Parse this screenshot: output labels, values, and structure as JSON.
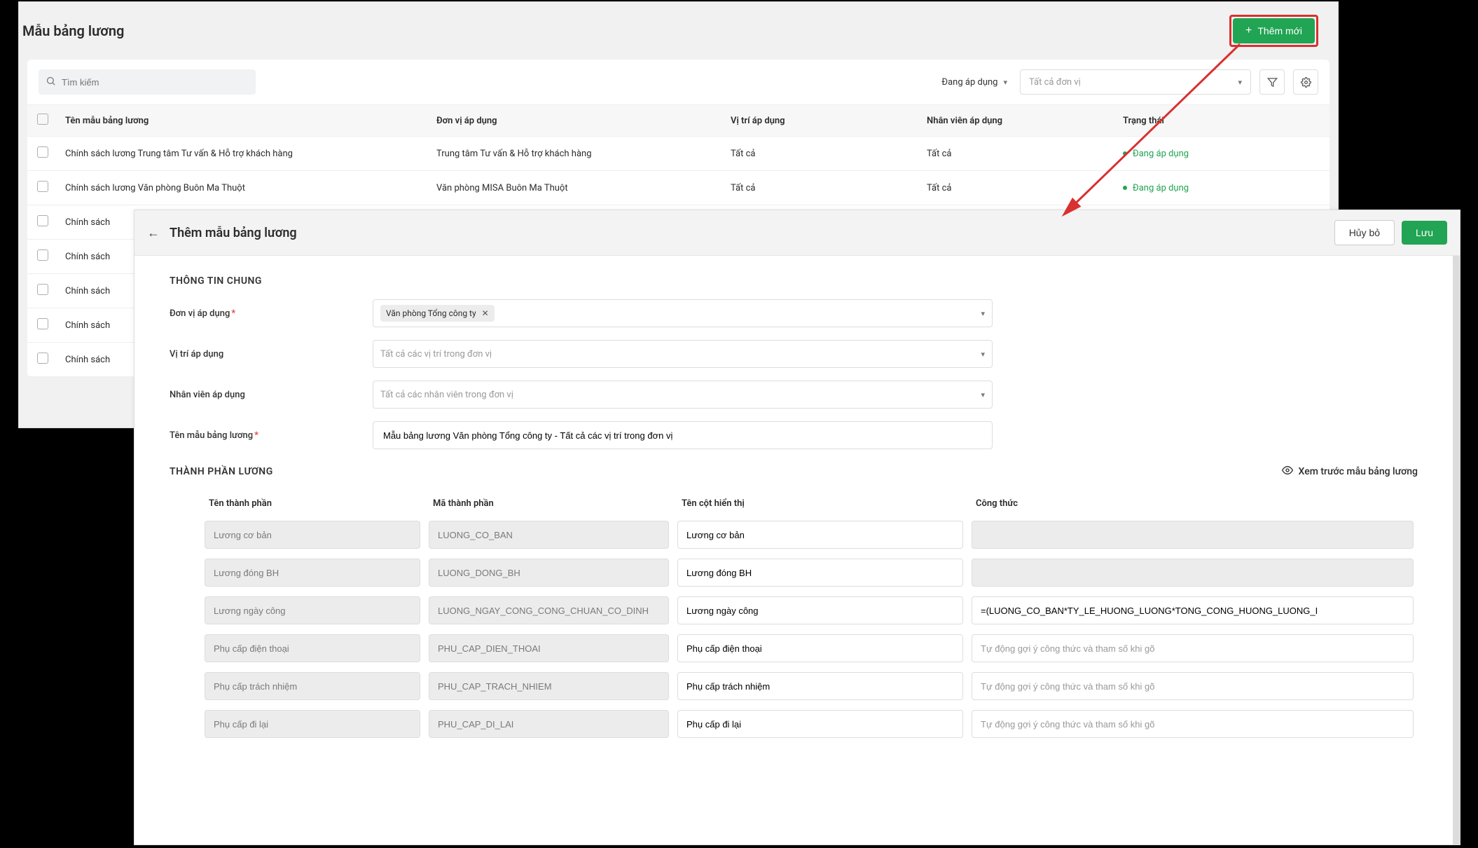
{
  "page": {
    "title": "Mẫu bảng lương",
    "add_button": "Thêm mới"
  },
  "toolbar": {
    "search_placeholder": "Tìm kiếm",
    "status_filter": "Đang áp dụng",
    "unit_filter": "Tất cả đơn vị"
  },
  "table": {
    "headers": {
      "name": "Tên mẫu bảng lương",
      "unit": "Đơn vị áp dụng",
      "position": "Vị trí áp dụng",
      "employee": "Nhân viên áp dụng",
      "status": "Trạng thái"
    },
    "rows": [
      {
        "name": "Chính sách lương Trung tâm Tư vấn & Hỗ trợ khách hàng",
        "unit": "Trung tâm Tư vấn & Hỗ trợ khách hàng",
        "position": "Tất cả",
        "employee": "Tất cả",
        "status": "Đang áp dụng"
      },
      {
        "name": "Chính sách lương Văn phòng Buôn Ma Thuột",
        "unit": "Văn phòng MISA Buôn Ma Thuột",
        "position": "Tất cả",
        "employee": "Tất cả",
        "status": "Đang áp dụng"
      },
      {
        "name": "Chính sách",
        "unit": "",
        "position": "",
        "employee": "",
        "status": ""
      },
      {
        "name": "Chính sách",
        "unit": "",
        "position": "",
        "employee": "",
        "status": ""
      },
      {
        "name": "Chính sách",
        "unit": "",
        "position": "",
        "employee": "",
        "status": ""
      },
      {
        "name": "Chính sách",
        "unit": "",
        "position": "",
        "employee": "",
        "status": ""
      },
      {
        "name": "Chính sách",
        "unit": "",
        "position": "",
        "employee": "",
        "status": ""
      }
    ]
  },
  "modal": {
    "title": "Thêm mẫu bảng lương",
    "cancel": "Hủy bỏ",
    "save": "Lưu",
    "section1": "THÔNG TIN CHUNG",
    "section2": "THÀNH PHẦN LƯƠNG",
    "preview": "Xem trước mẫu bảng lương",
    "form": {
      "unit_label": "Đơn vị áp dụng",
      "unit_chip": "Văn phòng Tổng công ty",
      "position_label": "Vị trí áp dụng",
      "position_placeholder": "Tất cả các vị trí trong đơn vị",
      "employee_label": "Nhân viên áp dụng",
      "employee_placeholder": "Tất cả các nhân viên trong đơn vị",
      "name_label": "Tên mẫu bảng lương",
      "name_value": "Mẫu bảng lương Văn phòng Tổng công ty - Tất cả các vị trí trong đơn vị"
    },
    "components": {
      "headers": {
        "name": "Tên thành phần",
        "code": "Mã thành phần",
        "display": "Tên cột hiển thị",
        "formula": "Công thức"
      },
      "formula_placeholder": "Tự động gợi ý công thức và tham số khi gõ",
      "rows": [
        {
          "name": "Lương cơ bản",
          "code": "LUONG_CO_BAN",
          "display": "Lương cơ bản",
          "formula": "",
          "formula_disabled": true
        },
        {
          "name": "Lương đóng BH",
          "code": "LUONG_DONG_BH",
          "display": "Lương đóng BH",
          "formula": "",
          "formula_disabled": true
        },
        {
          "name": "Lương ngày công",
          "code": "LUONG_NGAY_CONG_CONG_CHUAN_CO_DINH",
          "display": "Lương ngày công",
          "formula": "=(LUONG_CO_BAN*TY_LE_HUONG_LUONG*TONG_CONG_HUONG_LUONG_I",
          "formula_disabled": false
        },
        {
          "name": "Phụ cấp điện thoại",
          "code": "PHU_CAP_DIEN_THOAI",
          "display": "Phụ cấp điện thoại",
          "formula": "",
          "formula_disabled": false
        },
        {
          "name": "Phụ cấp trách nhiệm",
          "code": "PHU_CAP_TRACH_NHIEM",
          "display": "Phụ cấp trách nhiệm",
          "formula": "",
          "formula_disabled": false
        },
        {
          "name": "Phụ cấp đi lại",
          "code": "PHU_CAP_DI_LAI",
          "display": "Phụ cấp đi lại",
          "formula": "",
          "formula_disabled": false
        }
      ]
    }
  }
}
